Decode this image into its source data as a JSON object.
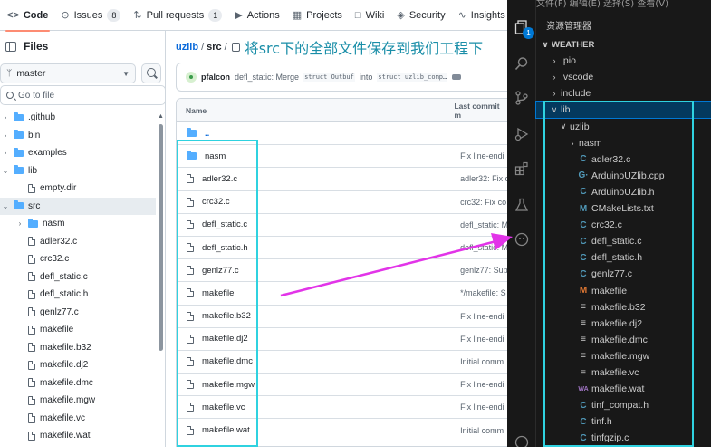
{
  "github": {
    "tabs": [
      {
        "icon": "code-icon",
        "glyph": "<>",
        "label": "Code",
        "count": null,
        "active": true
      },
      {
        "icon": "issues-icon",
        "glyph": "⊙",
        "label": "Issues",
        "count": "8",
        "active": false
      },
      {
        "icon": "pull-request-icon",
        "glyph": "⇅",
        "label": "Pull requests",
        "count": "1",
        "active": false
      },
      {
        "icon": "actions-icon",
        "glyph": "▶",
        "label": "Actions",
        "count": null,
        "active": false
      },
      {
        "icon": "projects-icon",
        "glyph": "▦",
        "label": "Projects",
        "count": null,
        "active": false
      },
      {
        "icon": "wiki-icon",
        "glyph": "□",
        "label": "Wiki",
        "count": null,
        "active": false
      },
      {
        "icon": "security-icon",
        "glyph": "◈",
        "label": "Security",
        "count": null,
        "active": false
      },
      {
        "icon": "insights-icon",
        "glyph": "∿",
        "label": "Insights",
        "count": null,
        "active": false
      }
    ],
    "files_title": "Files",
    "branch": "master",
    "goto_placeholder": "Go to file",
    "tree": [
      {
        "label": ".github",
        "type": "folder",
        "depth": 0,
        "expanded": false
      },
      {
        "label": "bin",
        "type": "folder",
        "depth": 0,
        "expanded": false
      },
      {
        "label": "examples",
        "type": "folder",
        "depth": 0,
        "expanded": false
      },
      {
        "label": "lib",
        "type": "folder",
        "depth": 0,
        "expanded": true
      },
      {
        "label": "empty.dir",
        "type": "file",
        "depth": 1
      },
      {
        "label": "src",
        "type": "folder",
        "depth": 0,
        "expanded": true,
        "selected": true
      },
      {
        "label": "nasm",
        "type": "folder",
        "depth": 1,
        "expanded": false
      },
      {
        "label": "adler32.c",
        "type": "file",
        "depth": 1
      },
      {
        "label": "crc32.c",
        "type": "file",
        "depth": 1
      },
      {
        "label": "defl_static.c",
        "type": "file",
        "depth": 1
      },
      {
        "label": "defl_static.h",
        "type": "file",
        "depth": 1
      },
      {
        "label": "genlz77.c",
        "type": "file",
        "depth": 1
      },
      {
        "label": "makefile",
        "type": "file",
        "depth": 1
      },
      {
        "label": "makefile.b32",
        "type": "file",
        "depth": 1
      },
      {
        "label": "makefile.dj2",
        "type": "file",
        "depth": 1
      },
      {
        "label": "makefile.dmc",
        "type": "file",
        "depth": 1
      },
      {
        "label": "makefile.mgw",
        "type": "file",
        "depth": 1
      },
      {
        "label": "makefile.vc",
        "type": "file",
        "depth": 1
      },
      {
        "label": "makefile.wat",
        "type": "file",
        "depth": 1
      }
    ],
    "breadcrumb": {
      "repo": "uzlib",
      "sep1": "/",
      "dir": "src",
      "sep2": "/"
    },
    "annotation": "将src下的全部文件保存到我们工程下",
    "commit": {
      "author": "pfalcon",
      "msg_pre": "defl_static: Merge",
      "code1": "struct Outbuf",
      "msg_mid": "into",
      "code2": "struct uzlib_comp…"
    },
    "table_headers": {
      "name": "Name",
      "commit": "Last commit m"
    },
    "rows": [
      {
        "name": "..",
        "type": "up",
        "commit": ""
      },
      {
        "name": "nasm",
        "type": "folder",
        "commit": "Fix line-endi"
      },
      {
        "name": "adler32.c",
        "type": "file",
        "commit": "adler32: Fix c"
      },
      {
        "name": "crc32.c",
        "type": "file",
        "commit": "crc32: Fix co"
      },
      {
        "name": "defl_static.c",
        "type": "file",
        "commit": "defl_static: M"
      },
      {
        "name": "defl_static.h",
        "type": "file",
        "commit": "defl_static: M"
      },
      {
        "name": "genlz77.c",
        "type": "file",
        "commit": "genlz77: Sup"
      },
      {
        "name": "makefile",
        "type": "file",
        "commit": "*/makefile: S"
      },
      {
        "name": "makefile.b32",
        "type": "file",
        "commit": "Fix line-endi"
      },
      {
        "name": "makefile.dj2",
        "type": "file",
        "commit": "Fix line-endi"
      },
      {
        "name": "makefile.dmc",
        "type": "file",
        "commit": "Initial comm"
      },
      {
        "name": "makefile.mgw",
        "type": "file",
        "commit": "Fix line-endi"
      },
      {
        "name": "makefile.vc",
        "type": "file",
        "commit": "Fix line-endi"
      },
      {
        "name": "makefile.wat",
        "type": "file",
        "commit": "Initial comm"
      }
    ]
  },
  "vscode": {
    "menu": "文件(F)  编辑(E)  选择(S)  查看(V)",
    "explorer_title": "资源管理器",
    "source_control_badge": "1",
    "rows": [
      {
        "label": "WEATHER",
        "depth": 0,
        "chev": "∨",
        "icon": "",
        "icon_class": "",
        "section": true
      },
      {
        "label": ".pio",
        "depth": 1,
        "chev": "›",
        "icon": "",
        "icon_class": ""
      },
      {
        "label": ".vscode",
        "depth": 1,
        "chev": "›",
        "icon": "",
        "icon_class": ""
      },
      {
        "label": "include",
        "depth": 1,
        "chev": "›",
        "icon": "",
        "icon_class": ""
      },
      {
        "label": "lib",
        "depth": 1,
        "chev": "∨",
        "icon": "",
        "icon_class": "",
        "selected": true
      },
      {
        "label": "uzlib",
        "depth": 2,
        "chev": "∨",
        "icon": "",
        "icon_class": ""
      },
      {
        "label": "nasm",
        "depth": 3,
        "chev": "›",
        "icon": "",
        "icon_class": ""
      },
      {
        "label": "adler32.c",
        "depth": 3,
        "chev": "",
        "icon": "C",
        "icon_class": "ic-c"
      },
      {
        "label": "ArduinoUZlib.cpp",
        "depth": 3,
        "chev": "",
        "icon": "G·",
        "icon_class": "ic-cpp"
      },
      {
        "label": "ArduinoUZlib.h",
        "depth": 3,
        "chev": "",
        "icon": "C",
        "icon_class": "ic-c"
      },
      {
        "label": "CMakeLists.txt",
        "depth": 3,
        "chev": "",
        "icon": "M",
        "icon_class": "ic-cm"
      },
      {
        "label": "crc32.c",
        "depth": 3,
        "chev": "",
        "icon": "C",
        "icon_class": "ic-c"
      },
      {
        "label": "defl_static.c",
        "depth": 3,
        "chev": "",
        "icon": "C",
        "icon_class": "ic-c"
      },
      {
        "label": "defl_static.h",
        "depth": 3,
        "chev": "",
        "icon": "C",
        "icon_class": "ic-c"
      },
      {
        "label": "genlz77.c",
        "depth": 3,
        "chev": "",
        "icon": "C",
        "icon_class": "ic-c"
      },
      {
        "label": "makefile",
        "depth": 3,
        "chev": "",
        "icon": "M",
        "icon_class": "ic-m"
      },
      {
        "label": "makefile.b32",
        "depth": 3,
        "chev": "",
        "icon": "≡",
        "icon_class": "ic-eq"
      },
      {
        "label": "makefile.dj2",
        "depth": 3,
        "chev": "",
        "icon": "≡",
        "icon_class": "ic-eq"
      },
      {
        "label": "makefile.dmc",
        "depth": 3,
        "chev": "",
        "icon": "≡",
        "icon_class": "ic-eq"
      },
      {
        "label": "makefile.mgw",
        "depth": 3,
        "chev": "",
        "icon": "≡",
        "icon_class": "ic-eq"
      },
      {
        "label": "makefile.vc",
        "depth": 3,
        "chev": "",
        "icon": "≡",
        "icon_class": "ic-eq"
      },
      {
        "label": "makefile.wat",
        "depth": 3,
        "chev": "",
        "icon": "WA",
        "icon_class": "ic-wa"
      },
      {
        "label": "tinf_compat.h",
        "depth": 3,
        "chev": "",
        "icon": "C",
        "icon_class": "ic-c"
      },
      {
        "label": "tinf.h",
        "depth": 3,
        "chev": "",
        "icon": "C",
        "icon_class": "ic-c"
      },
      {
        "label": "tinfgzip.c",
        "depth": 3,
        "chev": "",
        "icon": "C",
        "icon_class": "ic-c"
      }
    ]
  },
  "colors": {
    "highlight_box": "#2fd2e0",
    "arrow": "#e234e8",
    "vscode_bg": "#181818",
    "link": "#0969da"
  }
}
